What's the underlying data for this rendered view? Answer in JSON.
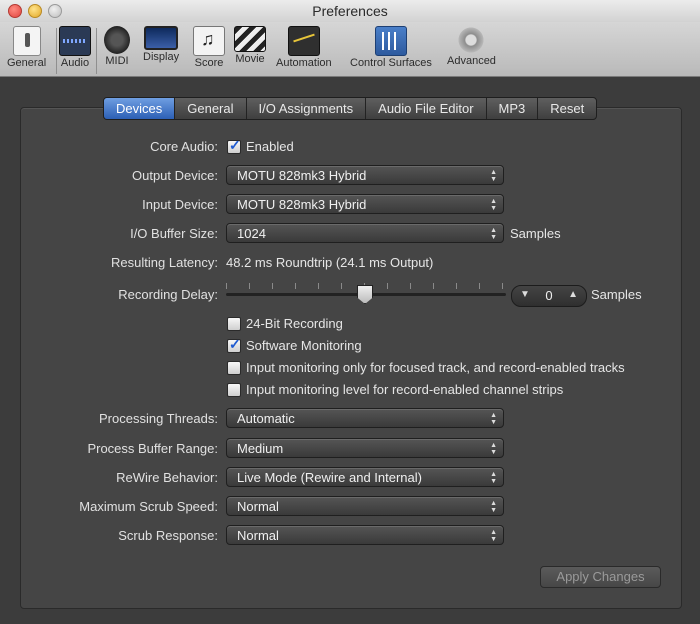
{
  "window": {
    "title": "Preferences"
  },
  "toolbar": {
    "items": [
      {
        "label": "General",
        "icon": "general-switch-icon"
      },
      {
        "label": "Audio",
        "icon": "audio-waveform-icon"
      },
      {
        "label": "MIDI",
        "icon": "midi-connector-icon"
      },
      {
        "label": "Display",
        "icon": "display-monitor-icon"
      },
      {
        "label": "Score",
        "icon": "score-notes-icon"
      },
      {
        "label": "Movie",
        "icon": "movie-clapper-icon"
      },
      {
        "label": "Automation",
        "icon": "automation-curve-icon"
      },
      {
        "label": "Control Surfaces",
        "icon": "control-surfaces-faders-icon"
      },
      {
        "label": "Advanced",
        "icon": "advanced-gear-icon"
      }
    ]
  },
  "tabs": [
    "Devices",
    "General",
    "I/O Assignments",
    "Audio File Editor",
    "MP3",
    "Reset"
  ],
  "active_tab": "Devices",
  "devices": {
    "core_audio": {
      "label": "Core Audio:",
      "checkbox_label": "Enabled",
      "checked": true
    },
    "output_device": {
      "label": "Output Device:",
      "value": "MOTU 828mk3 Hybrid"
    },
    "input_device": {
      "label": "Input Device:",
      "value": "MOTU 828mk3 Hybrid"
    },
    "io_buffer": {
      "label": "I/O Buffer Size:",
      "value": "1024",
      "unit": "Samples"
    },
    "latency": {
      "label": "Resulting Latency:",
      "value": "48.2 ms Roundtrip (24.1 ms Output)"
    },
    "recording_delay": {
      "label": "Recording Delay:",
      "value": "0",
      "unit": "Samples"
    },
    "options": [
      {
        "label": "24-Bit Recording",
        "checked": false
      },
      {
        "label": "Software Monitoring",
        "checked": true
      },
      {
        "label": "Input monitoring only for focused track, and record-enabled tracks",
        "checked": false
      },
      {
        "label": "Input monitoring level for record-enabled channel strips",
        "checked": false
      }
    ],
    "processing_threads": {
      "label": "Processing Threads:",
      "value": "Automatic"
    },
    "process_buffer_range": {
      "label": "Process Buffer Range:",
      "value": "Medium"
    },
    "rewire_behavior": {
      "label": "ReWire Behavior:",
      "value": "Live Mode (Rewire and Internal)"
    },
    "max_scrub_speed": {
      "label": "Maximum Scrub Speed:",
      "value": "Normal"
    },
    "scrub_response": {
      "label": "Scrub Response:",
      "value": "Normal"
    }
  },
  "apply_button": {
    "label": "Apply Changes"
  }
}
